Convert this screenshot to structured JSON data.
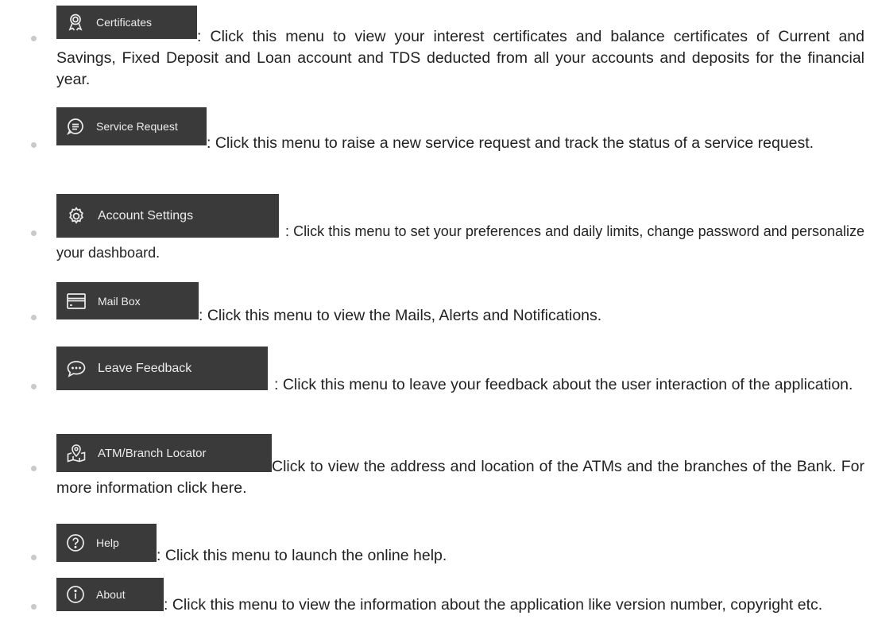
{
  "items": [
    {
      "icon": "certificate-ribbon-icon",
      "label": "Certificates",
      "description": ": Click this menu to view your interest certificates and balance certificates of Current and Savings, Fixed Deposit and Loan account and TDS deducted from all your accounts and deposits for the financial year."
    },
    {
      "icon": "chat-bubble-icon",
      "label": "Service Request",
      "description": ": Click this menu to raise a new service request and track the status of a service request."
    },
    {
      "icon": "gear-icon",
      "label": "Account Settings",
      "description": ": Click this menu to set your preferences and daily limits, change password and personalize your dashboard."
    },
    {
      "icon": "mailbox-card-icon",
      "label": "Mail Box",
      "description": ": Click this menu to view the Mails, Alerts and Notifications."
    },
    {
      "icon": "feedback-bubble-icon",
      "label": "Leave Feedback",
      "description": ": Click this menu to leave your feedback about the user interaction of the application."
    },
    {
      "icon": "location-map-icon",
      "label": "ATM/Branch Locator",
      "description": "Click to view the address and location of the ATMs and the branches of the Bank. For more information click here."
    },
    {
      "icon": "help-circle-icon",
      "label": "Help",
      "description": ": Click this menu to launch the online help."
    },
    {
      "icon": "info-circle-icon",
      "label": "About",
      "description": ": Click this menu to view the information about the application like version number, copyright etc."
    }
  ]
}
